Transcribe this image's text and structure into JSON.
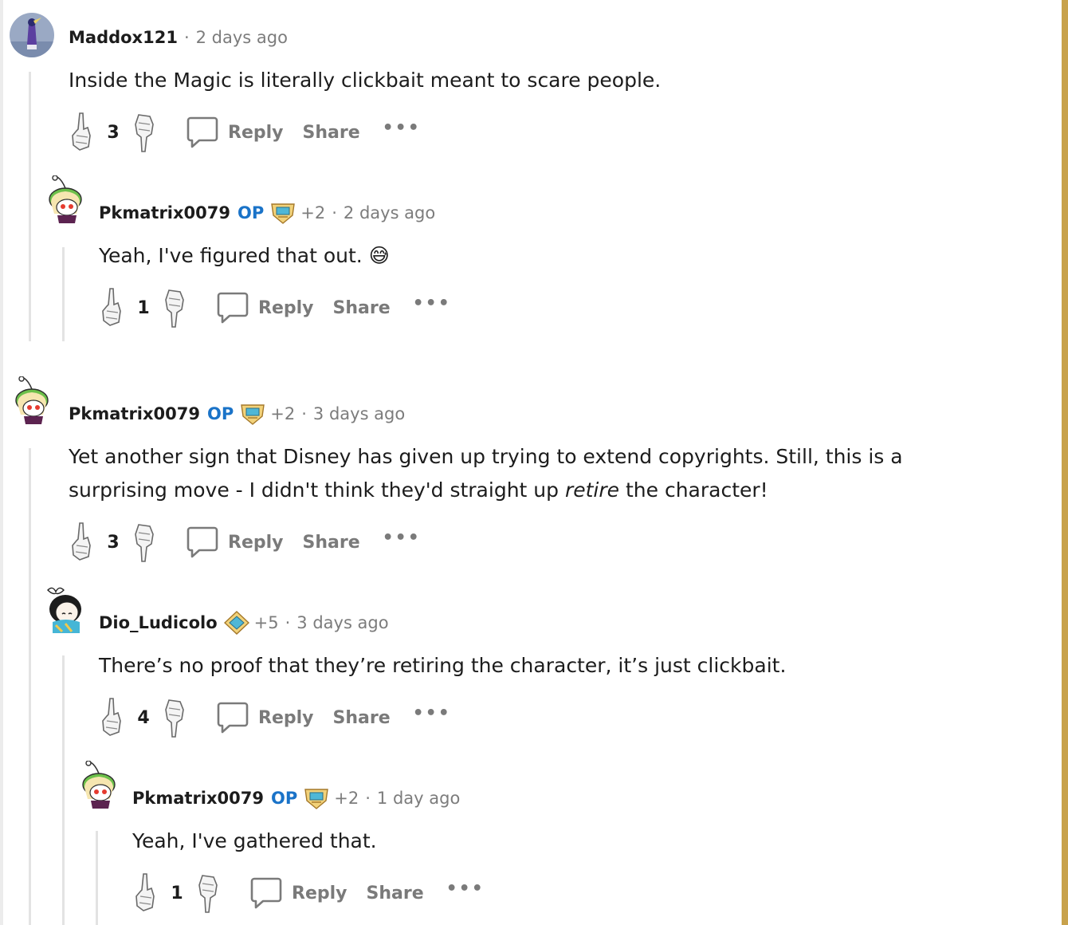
{
  "colors": {
    "op": "#1a73c8",
    "meta_gray": "#7c7c7c",
    "action_gray": "#7a7a7a",
    "thread_line": "#e3e3e3",
    "right_accent": "#c8a24c"
  },
  "comments": [
    {
      "username": "Maddox121",
      "op": "",
      "plus": "",
      "time": "2 days ago",
      "text": "Inside the Magic is literally clickbait meant to scare people.",
      "score": "3",
      "reply": "Reply",
      "share": "Share",
      "more": "•••"
    },
    {
      "username": "Pkmatrix0079",
      "op": "OP",
      "plus": "+2",
      "time": "2 days ago",
      "text": "Yeah, I've figured that out. 😅",
      "score": "1",
      "reply": "Reply",
      "share": "Share",
      "more": "•••"
    },
    {
      "username": "Pkmatrix0079",
      "op": "OP",
      "plus": "+2",
      "time": "3 days ago",
      "text_line1": "Yet another sign that Disney has given up trying to extend copyrights. Still, this is a",
      "text_line2_pre": "surprising move - I didn't think they'd straight up ",
      "text_line2_em": "retire",
      "text_line2_post": " the character!",
      "score": "3",
      "reply": "Reply",
      "share": "Share",
      "more": "•••"
    },
    {
      "username": "Dio_Ludicolo",
      "op": "",
      "plus": "+5",
      "time": "3 days ago",
      "text": "There’s no proof that they’re retiring the character, it’s just clickbait.",
      "score": "4",
      "reply": "Reply",
      "share": "Share",
      "more": "•••"
    },
    {
      "username": "Pkmatrix0079",
      "op": "OP",
      "plus": "+2",
      "time": "1 day ago",
      "text": "Yeah, I've gathered that.",
      "score": "1",
      "reply": "Reply",
      "share": "Share",
      "more": "•••"
    }
  ]
}
